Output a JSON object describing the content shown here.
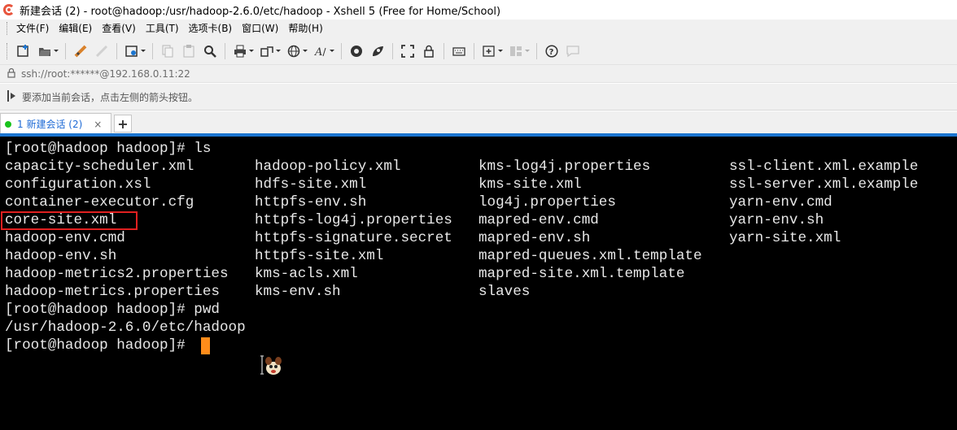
{
  "window": {
    "title": "新建会话 (2) - root@hadoop:/usr/hadoop-2.6.0/etc/hadoop - Xshell 5 (Free for Home/School)"
  },
  "menu": {
    "items": [
      "文件(F)",
      "编辑(E)",
      "查看(V)",
      "工具(T)",
      "选项卡(B)",
      "窗口(W)",
      "帮助(H)"
    ]
  },
  "toolbar": {
    "icons": [
      "new-session-icon",
      "open-folder-icon",
      "disconnect-icon",
      "reconnect-icon",
      "properties-icon",
      "copy-icon",
      "paste-icon",
      "find-icon",
      "print-icon",
      "transfer-icon",
      "globe-icon",
      "font-icon",
      "xftp-icon",
      "xmanager-icon",
      "fullscreen-icon",
      "lock-icon",
      "keyboard-icon",
      "add-tab-icon",
      "layout-icon",
      "help-icon",
      "chat-icon"
    ]
  },
  "address": {
    "text": "ssh://root:******@192.168.0.11:22"
  },
  "tip": {
    "text": "要添加当前会话，点击左侧的箭头按钮。"
  },
  "tabs": [
    {
      "label": "1 新建会话 (2)",
      "close": "×",
      "status_color": "#19c31c"
    }
  ],
  "tab_add": "+",
  "terminal": {
    "lines": [
      "[root@hadoop hadoop]# ls"
    ],
    "ls_columns": [
      [
        "capacity-scheduler.xml",
        "configuration.xsl",
        "container-executor.cfg",
        "core-site.xml",
        "hadoop-env.cmd",
        "hadoop-env.sh",
        "hadoop-metrics2.properties",
        "hadoop-metrics.properties"
      ],
      [
        "hadoop-policy.xml",
        "hdfs-site.xml",
        "httpfs-env.sh",
        "httpfs-log4j.properties",
        "httpfs-signature.secret",
        "httpfs-site.xml",
        "kms-acls.xml",
        "kms-env.sh"
      ],
      [
        "kms-log4j.properties",
        "kms-site.xml",
        "log4j.properties",
        "mapred-env.cmd",
        "mapred-env.sh",
        "mapred-queues.xml.template",
        "mapred-site.xml.template",
        "slaves"
      ],
      [
        "ssl-client.xml.example",
        "ssl-server.xml.example",
        "yarn-env.cmd",
        "yarn-env.sh",
        "yarn-site.xml"
      ]
    ],
    "after_lines": [
      "[root@hadoop hadoop]# pwd",
      "/usr/hadoop-2.6.0/etc/hadoop",
      "[root@hadoop hadoop]# "
    ],
    "highlighted_file": "core-site.xml",
    "cursor_color": "#ff8c1a",
    "highlight_color": "#e02020"
  }
}
